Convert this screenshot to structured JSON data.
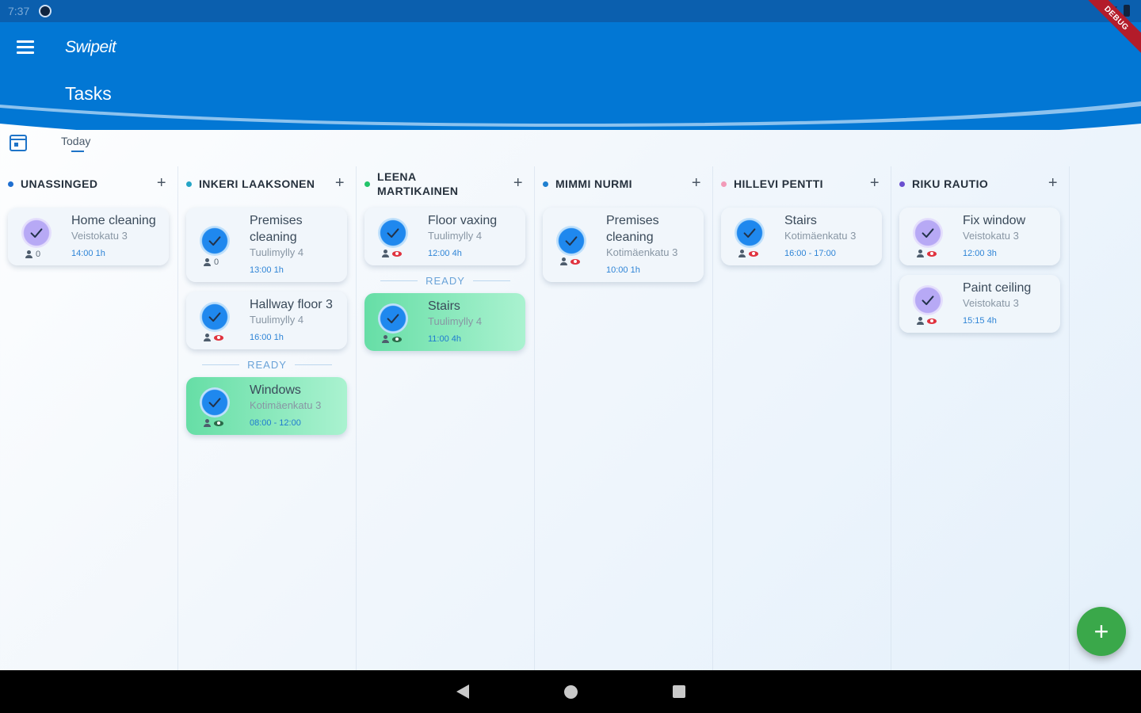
{
  "status_bar": {
    "time": "7:37"
  },
  "debug_banner": "DEBUG",
  "app_bar": {
    "app_title": "Swipeit",
    "page_title": "Tasks"
  },
  "date_selector": {
    "label": "Today"
  },
  "fab_label": "+",
  "ready_label": "READY",
  "columns": [
    {
      "name": "UNASSINGED",
      "dot_color": "#1f6fd0",
      "tasks": [
        {
          "title": "Home cleaning",
          "address": "Veistokatu 3",
          "time": "14:00 1h",
          "icon": "purple",
          "meta": "0",
          "eye": ""
        }
      ],
      "ready_tasks": []
    },
    {
      "name": "INKERI LAAKSONEN",
      "dot_color": "#25a5c6",
      "tasks": [
        {
          "title": "Premises cleaning",
          "address": "Tuulimylly 4",
          "time": "13:00 1h",
          "icon": "blue",
          "meta": "0",
          "eye": ""
        },
        {
          "title": "Hallway floor 3",
          "address": "Tuulimylly 4",
          "time": "16:00 1h",
          "icon": "blue",
          "meta": "",
          "eye": "red"
        }
      ],
      "ready_tasks": [
        {
          "title": "Windows",
          "address": "Kotimäenkatu 3",
          "time": "08:00 - 12:00",
          "icon": "blue",
          "meta": "",
          "eye": "green"
        }
      ]
    },
    {
      "name": "LEENA MARTIKAINEN",
      "dot_color": "#22c46a",
      "tasks": [
        {
          "title": "Floor vaxing",
          "address": "Tuulimylly 4",
          "time": "12:00 4h",
          "icon": "blue",
          "meta": "",
          "eye": "red"
        }
      ],
      "ready_tasks": [
        {
          "title": "Stairs",
          "address": "Tuulimylly 4",
          "time": "11:00 4h",
          "icon": "blue",
          "meta": "",
          "eye": "green"
        }
      ]
    },
    {
      "name": "MIMMI NURMI",
      "dot_color": "#1f80d0",
      "tasks": [
        {
          "title": "Premises cleaning",
          "address": "Kotimäenkatu 3",
          "time": "10:00 1h",
          "icon": "blue",
          "meta": "",
          "eye": "red"
        }
      ],
      "ready_tasks": []
    },
    {
      "name": "HILLEVI PENTTI",
      "dot_color": "#f29ab8",
      "tasks": [
        {
          "title": "Stairs",
          "address": "Kotimäenkatu 3",
          "time": "16:00 - 17:00",
          "icon": "blue",
          "meta": "",
          "eye": "red"
        }
      ],
      "ready_tasks": []
    },
    {
      "name": "RIKU RAUTIO",
      "dot_color": "#6a4fd0",
      "tasks": [
        {
          "title": "Fix window",
          "address": "Veistokatu 3",
          "time": "12:00 3h",
          "icon": "purple",
          "meta": "",
          "eye": "red"
        },
        {
          "title": "Paint ceiling",
          "address": "Veistokatu 3",
          "time": "15:15 4h",
          "icon": "purple",
          "meta": "",
          "eye": "red"
        }
      ],
      "ready_tasks": []
    }
  ]
}
